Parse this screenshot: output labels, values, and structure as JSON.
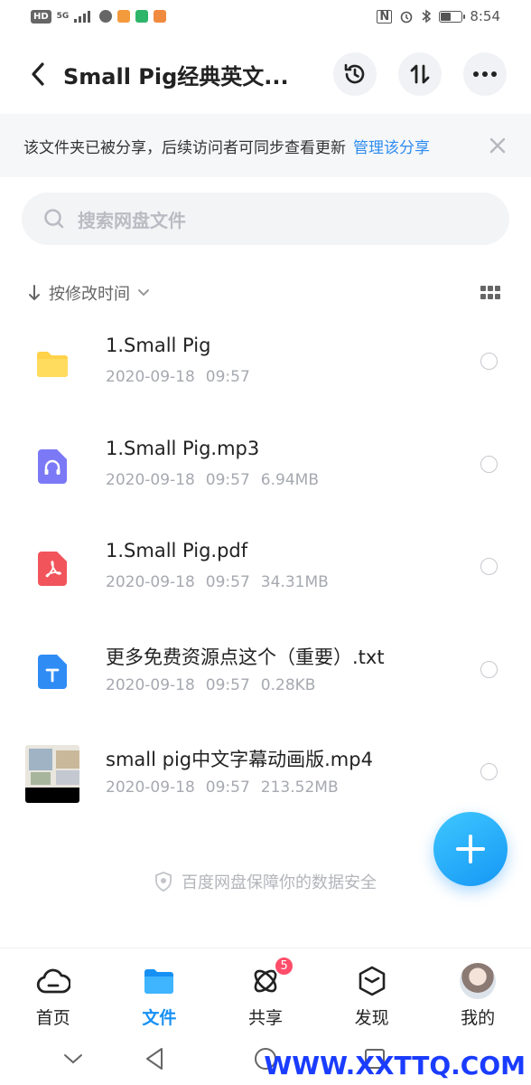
{
  "status_bar": {
    "left_chips": [
      "HD"
    ],
    "network": "5G",
    "time": "8:54",
    "battery_level_fraction": 0.45
  },
  "header": {
    "title": "Small Pig经典英文...",
    "back_icon": "chevron-left-icon",
    "history_icon": "history-icon",
    "sort_transfer_icon": "up-down-arrows-icon",
    "more_icon": "more-horizontal-icon"
  },
  "share_banner": {
    "text": "该文件夹已被分享，后续访问者可同步查看更新",
    "link": "管理该分享",
    "close_icon": "close-icon"
  },
  "search": {
    "placeholder": "搜索网盘文件",
    "icon": "search-icon"
  },
  "sort": {
    "label": "按修改时间",
    "direction_icon": "arrow-down-icon",
    "dropdown_icon": "chevron-down-icon",
    "view_icon": "grid-view-icon"
  },
  "files": [
    {
      "name": "1.Small Pig",
      "date": "2020-09-18",
      "time": "09:57",
      "size": "",
      "type": "folder"
    },
    {
      "name": "1.Small Pig.mp3",
      "date": "2020-09-18",
      "time": "09:57",
      "size": "6.94MB",
      "type": "audio"
    },
    {
      "name": "1.Small Pig.pdf",
      "date": "2020-09-18",
      "time": "09:57",
      "size": "34.31MB",
      "type": "pdf"
    },
    {
      "name": "更多免费资源点这个（重要）.txt",
      "date": "2020-09-18",
      "time": "09:57",
      "size": "0.28KB",
      "type": "text"
    },
    {
      "name": "small pig中文字幕动画版.mp4",
      "date": "2020-09-18",
      "time": "09:57",
      "size": "213.52MB",
      "type": "video"
    }
  ],
  "secure_note": "百度网盘保障你的数据安全",
  "fab_icon": "plus-icon",
  "tabs": [
    {
      "label": "首页",
      "icon": "cloud-icon",
      "active": false
    },
    {
      "label": "文件",
      "icon": "folder-icon",
      "active": true
    },
    {
      "label": "共享",
      "icon": "share-atom-icon",
      "active": false,
      "badge": "5"
    },
    {
      "label": "发现",
      "icon": "discover-cube-icon",
      "active": false
    },
    {
      "label": "我的",
      "icon": "avatar",
      "active": false
    }
  ],
  "watermark": "WWW.XXTTQ.COM",
  "colors": {
    "accent": "#1690f5",
    "link": "#2d8cf0",
    "badge": "#ff4d6a",
    "folder": "#ffd24a"
  }
}
